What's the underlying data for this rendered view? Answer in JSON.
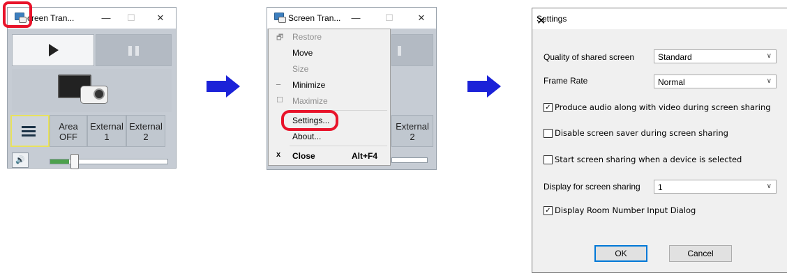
{
  "window1": {
    "title": "creen Tran...",
    "minimize": "—",
    "maximize": "☐",
    "close": "✕",
    "inputs": [
      {
        "label": "",
        "icon": "list-icon"
      },
      {
        "label": "Area\nOFF"
      },
      {
        "label": "External\n1"
      },
      {
        "label": "External\n2"
      }
    ],
    "volume_level": 0.16
  },
  "window2": {
    "title": "Screen Tran...",
    "minimize": "—",
    "maximize": "☐",
    "close": "✕",
    "partial_button": "External\n2"
  },
  "context_menu": {
    "items": [
      {
        "label": "Restore",
        "glyph": "🗗",
        "disabled": true
      },
      {
        "label": "Move",
        "glyph": "",
        "disabled": false
      },
      {
        "label": "Size",
        "glyph": "",
        "disabled": true
      },
      {
        "label": "Minimize",
        "glyph": "_",
        "disabled": false
      },
      {
        "label": "Maximize",
        "glyph": "☐",
        "disabled": true
      },
      {
        "label": "Settings...",
        "glyph": "",
        "disabled": false
      },
      {
        "label": "About...",
        "glyph": "",
        "disabled": false
      },
      {
        "label": "Close",
        "glyph": "x",
        "accelerator": "Alt+F4",
        "disabled": false,
        "bold": true
      }
    ]
  },
  "settings": {
    "title": "Settings",
    "close": "✕",
    "quality_label": "Quality of shared screen",
    "quality_value": "Standard",
    "frame_rate_label": "Frame Rate",
    "frame_rate_value": "Normal",
    "audio_label": "Produce audio along with video during screen sharing",
    "audio_checked": true,
    "saver_label": "Disable screen saver during screen sharing",
    "saver_checked": false,
    "autostart_label": "Start screen sharing when a device is selected",
    "autostart_checked": false,
    "display_label": "Display for screen sharing",
    "display_value": "1",
    "room_label": "Display Room Number Input Dialog",
    "room_checked": true,
    "ok": "OK",
    "cancel": "Cancel"
  },
  "colors": {
    "arrow": "#1b22d8",
    "highlight": "#e8132a",
    "panel": "#c6ccd4"
  }
}
